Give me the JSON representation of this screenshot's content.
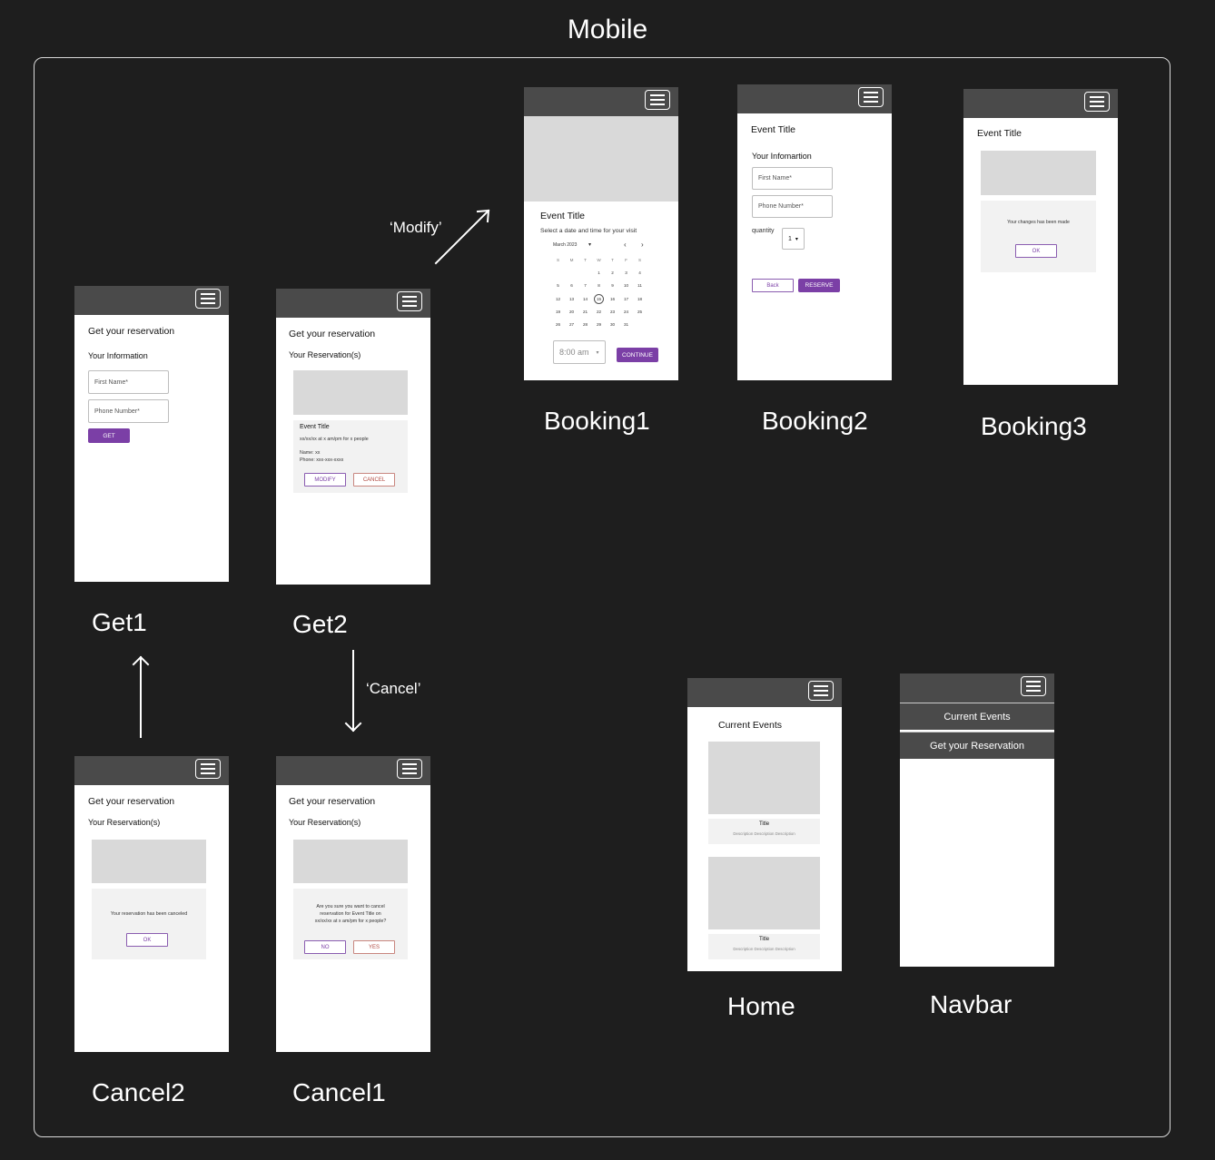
{
  "title": "Mobile",
  "annotations": {
    "modify": "‘Modify’",
    "cancel": "‘Cancel’"
  },
  "colors": {
    "background": "#1e1e1e",
    "header": "#4a4a4a",
    "accent": "#7b3fa6",
    "placeholder": "#d9d9d9"
  },
  "screens": {
    "booking1": {
      "label": "Booking1",
      "event_title": "Event Title",
      "subtitle": "Select a date and time for your visit",
      "month": "March 2023",
      "weekdays": [
        "S",
        "M",
        "T",
        "W",
        "T",
        "F",
        "S"
      ],
      "days": [
        "",
        "",
        "",
        "1",
        "2",
        "3",
        "4",
        "5",
        "6",
        "7",
        "8",
        "9",
        "10",
        "11",
        "12",
        "13",
        "14",
        "15",
        "16",
        "17",
        "18",
        "19",
        "20",
        "21",
        "22",
        "23",
        "24",
        "25",
        "26",
        "27",
        "28",
        "29",
        "30",
        "31",
        "",
        ""
      ],
      "selected_day": "15",
      "time": "8:00 am",
      "continue": "CONTINUE"
    },
    "booking2": {
      "label": "Booking2",
      "event_title": "Event Title",
      "section": "Your Infomartion",
      "first_name": "First Name*",
      "phone": "Phone Number*",
      "quantity_label": "quantity",
      "quantity": "1",
      "back": "Back",
      "reserve": "RESERVE"
    },
    "booking3": {
      "label": "Booking3",
      "event_title": "Event Title",
      "message": "Your changes has been made",
      "ok": "OK"
    },
    "get1": {
      "label": "Get1",
      "title": "Get your reservation",
      "section": "Your Information",
      "first_name": "First Name*",
      "phone": "Phone Number*",
      "get": "GET"
    },
    "get2": {
      "label": "Get2",
      "title": "Get your reservation",
      "section": "Your Reservation(s)",
      "event_title": "Event Title",
      "details": "xx/xx/xx at x am/pm for x people",
      "name": "Name: xx",
      "phone": "Phone: xxx-xxx-xxxx",
      "modify": "MODIFY",
      "cancel": "CANCEL"
    },
    "cancel1": {
      "label": "Cancel1",
      "title": "Get your reservation",
      "section": "Your Reservation(s)",
      "confirm_l1": "Are you sure you want to cancel",
      "confirm_l2": "reservation for Event Title on",
      "confirm_l3": "xx/xx/xx at x am/pm for x people?",
      "no": "NO",
      "yes": "YES"
    },
    "cancel2": {
      "label": "Cancel2",
      "title": "Get your reservation",
      "section": "Your Reservation(s)",
      "message": "Your reservation has been canceled",
      "ok": "OK"
    },
    "home": {
      "label": "Home",
      "heading": "Current Events",
      "cards": [
        {
          "title": "Title",
          "desc": "Description Description Description"
        },
        {
          "title": "Title",
          "desc": "Description Description Description"
        }
      ]
    },
    "navbar": {
      "label": "Navbar",
      "items": [
        "Current Events",
        "Get your Reservation"
      ]
    }
  }
}
